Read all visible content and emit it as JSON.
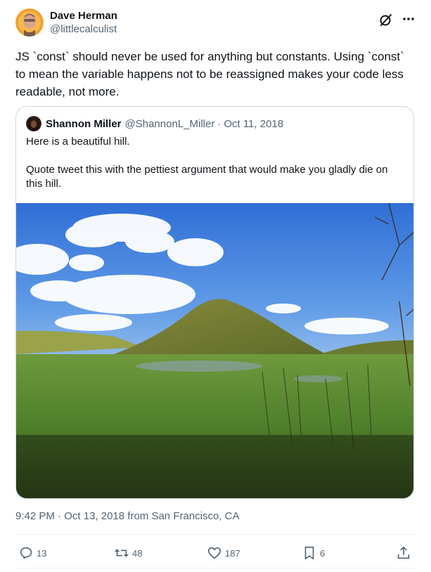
{
  "author": {
    "display_name": "Dave Herman",
    "handle": "@littlecalculist",
    "avatar_icon": "user-avatar-orange"
  },
  "header_icons": {
    "grok": "grok-icon",
    "more": "more-icon"
  },
  "tweet": {
    "text": "JS `const` should never be used for anything but constants. Using `const` to mean the variable happens not to be reassigned makes your code less readable, not more."
  },
  "quoted": {
    "display_name": "Shannon Miller",
    "handle": "@ShannonL_Miller",
    "separator": "·",
    "date": "Oct 11, 2018",
    "line1": "Here is a beautiful hill.",
    "line2": "Quote tweet this with the pettiest argument that would make you gladly die on this hill."
  },
  "meta": {
    "time": "9:42 PM",
    "separator": "·",
    "date": "Oct 13, 2018",
    "location": "from San Francisco, CA"
  },
  "actions": {
    "replies": "13",
    "retweets": "48",
    "likes": "187",
    "bookmarks": "6"
  },
  "colors": {
    "text": "#0f1419",
    "secondary": "#536471",
    "border": "#cfd9de",
    "divider": "#eff3f4"
  }
}
